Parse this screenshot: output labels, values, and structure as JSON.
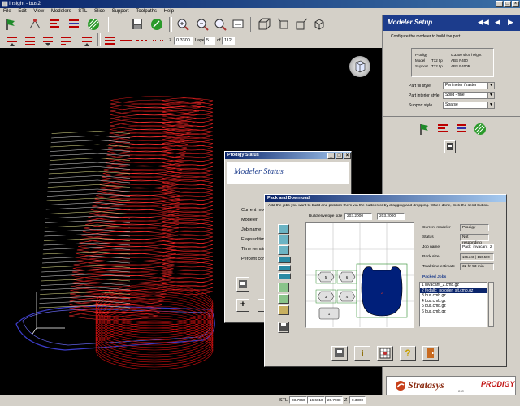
{
  "app": {
    "title": "Insight - bus2",
    "title_fragment": "Insight - bus2"
  },
  "menu": [
    "File",
    "Edit",
    "View",
    "Modelers",
    "STL",
    "Slice",
    "Support",
    "Toolpaths",
    "Help"
  ],
  "toolbar": {
    "slice_height_label": "Z",
    "slice_value": "0.3300",
    "layer_label": "Layer",
    "layer_value": "5",
    "of_label": "of",
    "of_value": "112"
  },
  "right_panel": {
    "title": "Modeler Setup",
    "subtitle": "Configure the modeler to build the part.",
    "info": {
      "modeler_name": "Prodigy",
      "slice_height": "0.3300 slice height",
      "model_label": "Model",
      "model_tip": "T12 tip",
      "model_material": "ABS P400",
      "support_label": "Support",
      "support_tip": "T12 tip",
      "support_material": "ABS P400R"
    },
    "fields": [
      {
        "label": "Part fill style",
        "value": "Perimeter / raster"
      },
      {
        "label": "Part interior style",
        "value": "Solid - fine"
      },
      {
        "label": "Support style",
        "value": "Sparse"
      }
    ],
    "logo_text": "Stratasys",
    "logo_sub": "PRODIGY",
    "logo_inc": "INC"
  },
  "status_dialog": {
    "window_title": "Prodigy Status",
    "heading": "Modeler Status",
    "rows": [
      "Current mode",
      "Modeler",
      "Job name",
      "Elapsed time",
      "Time remain",
      "Percent comp"
    ]
  },
  "pack_dialog": {
    "window_title": "Pack and Download",
    "instructions": "Add the jobs you want to build and position them via the buttons or by dragging and dropping. When done, click the send button.",
    "envelope_label": "Build envelope size",
    "envelope_x": "203.2000",
    "envelope_y": "203.2000",
    "fields": [
      {
        "label": "Current modeler",
        "value": "Prodigy"
      },
      {
        "label": "Status",
        "value": "Not responding"
      },
      {
        "label": "Job name",
        "value": "Pack_invacant_2"
      },
      {
        "label": "Pack size",
        "value": "166.240 | 160.500"
      },
      {
        "label": "Total time estimate",
        "value": "32 hr 53 min"
      }
    ],
    "packed_jobs_label": "Packed Jobs",
    "jobs": [
      "1  invacant_2.cmb.gz",
      "2  fedallc_poloder_slt.cmb.gz",
      "3  bus.cmb.gz",
      "4  bus.cmb.gz",
      "5  bus.cmb.gz",
      "6  bus.cmb.gz"
    ],
    "selected_job": 1,
    "part_labels": [
      "5",
      "6",
      "3",
      "4",
      "1",
      "2"
    ]
  },
  "status_bar": {
    "mode": "STL",
    "coord_x": "23.7660",
    "coord_y": "16.6010",
    "coord_z": "26.7980",
    "z_label": "Z",
    "z_value": "0.3300"
  },
  "colors": {
    "titlebar": "#0a246a",
    "accent_red": "#cc1111",
    "model_green": "#2a8a2a",
    "part_navy": "#001f7a",
    "list_select": "#0a246a"
  }
}
